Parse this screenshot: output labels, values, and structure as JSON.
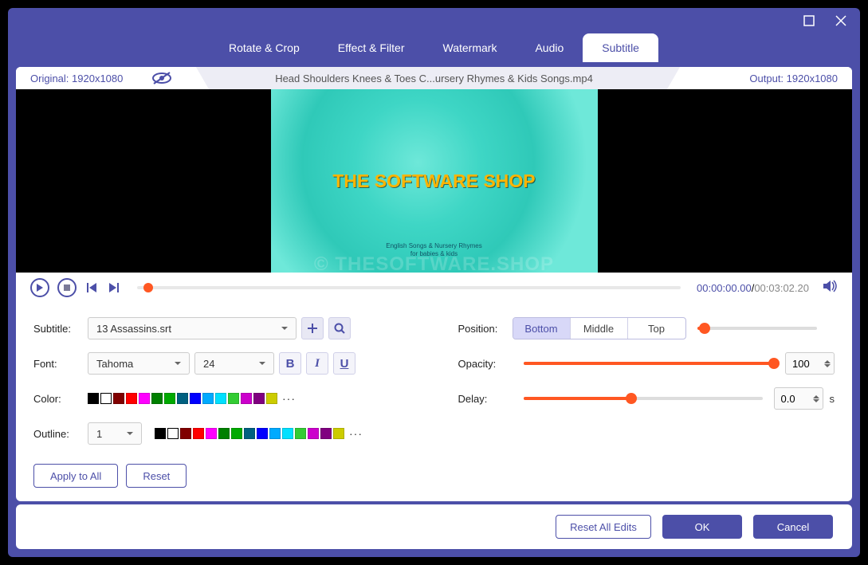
{
  "window": {
    "tabs": [
      "Rotate & Crop",
      "Effect & Filter",
      "Watermark",
      "Audio",
      "Subtitle"
    ],
    "active_tab": 4
  },
  "filebar": {
    "original": "Original: 1920x1080",
    "filename": "Head Shoulders Knees & Toes  C...ursery Rhymes & Kids Songs.mp4",
    "output": "Output: 1920x1080"
  },
  "preview": {
    "subtitle_text": "THE SOFTWARE SHOP",
    "watermark_overlay": "© THESOFTWARE.SHOP"
  },
  "playback": {
    "current_time": "00:00:00.00",
    "total_time": "00:03:02.20"
  },
  "subtitle": {
    "label": "Subtitle:",
    "file": "13 Assassins.srt"
  },
  "font": {
    "label": "Font:",
    "family": "Tahoma",
    "size": "24"
  },
  "color": {
    "label": "Color:",
    "swatches": [
      "#000000",
      "#ffffff-open",
      "#800000",
      "#ff0000",
      "#ff00ff",
      "#008000",
      "#00aa00",
      "#006080",
      "#0000ff",
      "#00aaff",
      "#00e0ff",
      "#33cc33",
      "#cc00cc",
      "#800080",
      "#cccc00"
    ]
  },
  "outline": {
    "label": "Outline:",
    "width": "1",
    "swatches": [
      "#000000",
      "#ffffff-open",
      "#800000",
      "#ff0000",
      "#ff00ff",
      "#008000",
      "#00aa00",
      "#006080",
      "#0000ff",
      "#00aaff",
      "#00e0ff",
      "#33cc33",
      "#cc00cc",
      "#800080",
      "#cccc00"
    ]
  },
  "position": {
    "label": "Position:",
    "options": [
      "Bottom",
      "Middle",
      "Top"
    ],
    "selected": 0,
    "slider_pct": 6
  },
  "opacity": {
    "label": "Opacity:",
    "value": "100",
    "slider_pct": 100
  },
  "delay": {
    "label": "Delay:",
    "value": "0.0",
    "unit": "s",
    "slider_pct": 45
  },
  "buttons": {
    "apply_all": "Apply to All",
    "reset": "Reset",
    "reset_all": "Reset All Edits",
    "ok": "OK",
    "cancel": "Cancel"
  }
}
